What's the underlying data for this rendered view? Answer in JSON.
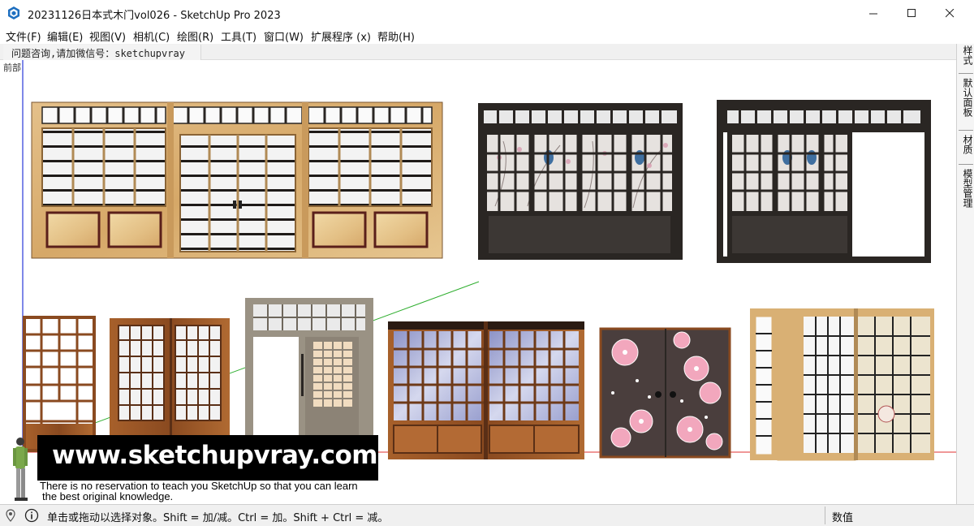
{
  "window": {
    "title": "20231126日本式木门vol026 - SketchUp Pro 2023",
    "icon": "sketchup-icon",
    "controls": [
      "minimize-icon",
      "maximize-icon",
      "close-icon"
    ]
  },
  "menubar": {
    "items": [
      {
        "label": "文件(F)"
      },
      {
        "label": "编辑(E)"
      },
      {
        "label": "视图(V)"
      },
      {
        "label": "相机(C)"
      },
      {
        "label": "绘图(R)"
      },
      {
        "label": "工具(T)"
      },
      {
        "label": "窗口(W)"
      },
      {
        "label": "扩展程序 (x)"
      },
      {
        "label": "帮助(H)"
      }
    ]
  },
  "toolbar": {
    "scene_tab_label": "问题咨询,请加微信号：sketchupvray"
  },
  "viewport": {
    "scene_label": "前部",
    "axis_colors": {
      "red": "#e03030",
      "green": "#2fae2f",
      "blue": "#2a3ad8"
    }
  },
  "right_tray": {
    "tabs": [
      {
        "label": "样式"
      },
      {
        "label": "默认面板"
      },
      {
        "label": "材质"
      },
      {
        "label": "模型管理"
      }
    ]
  },
  "watermark": {
    "url": "www.sketchupvray.com",
    "tagline_1": "There is no reservation to teach you SketchUp so that you can learn",
    "tagline_2": "the best original knowledge."
  },
  "statusbar": {
    "geo_icon": "location-pin-icon",
    "info_icon": "info-icon",
    "hint": "单击或拖动以选择对象。Shift = 加/减。Ctrl = 加。Shift + Ctrl = 减。",
    "measurements_label": "数值"
  },
  "colors": {
    "light_wood": "#d9b074",
    "dark_wood": "#2a2623",
    "medium_wood": "#9c5a2a",
    "grey_frame": "#9a9284",
    "blossom_bg": "#4a3e3d",
    "blossom_pink": "#f2a7bd"
  }
}
